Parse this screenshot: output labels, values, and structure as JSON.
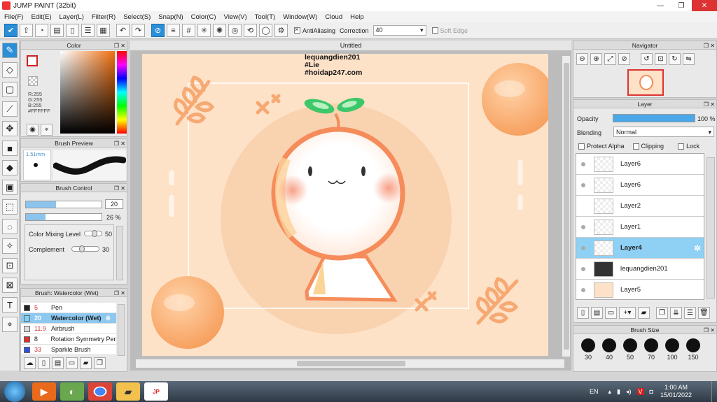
{
  "window": {
    "title": "JUMP PAINT (32bit)",
    "min": "—",
    "max": "❐",
    "close": "✕"
  },
  "menu": [
    "File(F)",
    "Edit(E)",
    "Layer(L)",
    "Filter(R)",
    "Select(S)",
    "Snap(N)",
    "Color(C)",
    "View(V)",
    "Tool(T)",
    "Window(W)",
    "Cloud",
    "Help"
  ],
  "toolbar": {
    "antialiasing_label": "AntiAliasing",
    "correction_label": "Correction",
    "correction_value": "40",
    "soft_edge_label": "Soft Edge"
  },
  "color_panel": {
    "title": "Color",
    "r": "R:255",
    "g": "G:255",
    "b": "B:255",
    "hex": "#FFFFFF"
  },
  "brush_preview": {
    "title": "Brush Preview",
    "size": "1.51mm"
  },
  "brush_control": {
    "title": "Brush Control",
    "size_value": "20",
    "opacity_value": "26 %",
    "opacity_fraction": 0.26,
    "size_fraction": 0.4,
    "color_mixing_label": "Color Mixing Level",
    "color_mixing_value": "50",
    "complement_label": "Complement",
    "complement_value": "30"
  },
  "brush_list": {
    "title": "Brush: Watercolor (Wet)",
    "items": [
      {
        "num": "5",
        "name": "Pen",
        "color": "#222222"
      },
      {
        "num": "20",
        "name": "Watercolor (Wet)",
        "color": "#7fd0f5",
        "selected": true
      },
      {
        "num": "11.9",
        "name": "Airbrush",
        "color": "#dddddd"
      },
      {
        "num": "8",
        "name": "Rotation Symmetry Pen",
        "color": "#e03030"
      },
      {
        "num": "33",
        "name": "Sparkle Brush",
        "color": "#3050e0"
      }
    ]
  },
  "document": {
    "tab_title": "Untitled",
    "watermark": [
      "lequangdien201",
      "#Lie",
      "#hoidap247.com"
    ]
  },
  "navigator": {
    "title": "Navigator"
  },
  "layer_panel": {
    "title": "Layer",
    "opacity_label": "Opacity",
    "opacity_value": "100 %",
    "blending_label": "Blending",
    "blending_value": "Normal",
    "protect_alpha": "Protect Alpha",
    "clipping": "Clipping",
    "lock": "Lock",
    "layers": [
      {
        "name": "Layer6",
        "selected": false
      },
      {
        "name": "Layer6",
        "selected": false
      },
      {
        "name": "Layer2",
        "selected": false
      },
      {
        "name": "Layer1",
        "selected": false
      },
      {
        "name": "Layer4",
        "selected": true
      },
      {
        "name": "lequangdien201",
        "selected": false
      },
      {
        "name": "Layer5",
        "selected": false
      }
    ]
  },
  "brush_size": {
    "title": "Brush Size",
    "sizes": [
      "30",
      "40",
      "50",
      "70",
      "100",
      "150"
    ]
  },
  "taskbar": {
    "lang": "EN",
    "time": "1:00 AM",
    "date": "15/01/2022"
  },
  "colors": {
    "accent": "#2b8fd8",
    "selected_row": "#8fd0f5",
    "canvas_bg": "#fde2c8",
    "peach": "#f7a36a"
  }
}
